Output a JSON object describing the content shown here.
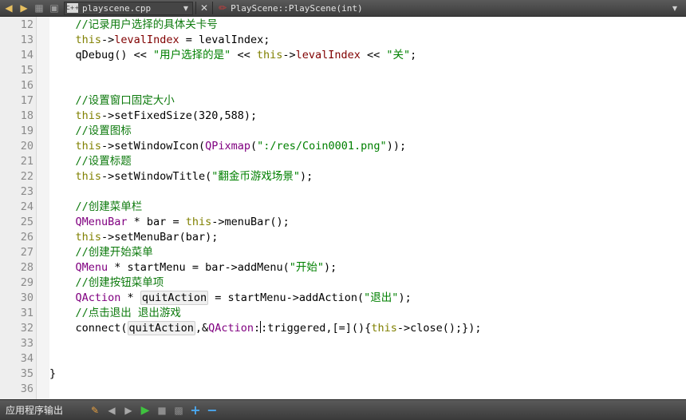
{
  "toolbar": {
    "file_name": "playscene.cpp",
    "file_badge": "C++",
    "symbol": "PlayScene::PlayScene(int)"
  },
  "editor": {
    "lines": [
      {
        "n": "12",
        "tokens": [
          {
            "t": "    //记录用户选择的具体关卡号",
            "c": "com"
          }
        ]
      },
      {
        "n": "13",
        "tokens": [
          {
            "t": "    ",
            "c": "def"
          },
          {
            "t": "this",
            "c": "kw"
          },
          {
            "t": "->",
            "c": "def"
          },
          {
            "t": "levalIndex",
            "c": "mem"
          },
          {
            "t": " = levalIndex;",
            "c": "def"
          }
        ]
      },
      {
        "n": "14",
        "tokens": [
          {
            "t": "    qDebug() << ",
            "c": "def"
          },
          {
            "t": "\"用户选择的是\"",
            "c": "str"
          },
          {
            "t": " << ",
            "c": "def"
          },
          {
            "t": "this",
            "c": "kw"
          },
          {
            "t": "->",
            "c": "def"
          },
          {
            "t": "levalIndex",
            "c": "mem"
          },
          {
            "t": " << ",
            "c": "def"
          },
          {
            "t": "\"关\"",
            "c": "str"
          },
          {
            "t": ";",
            "c": "def"
          }
        ]
      },
      {
        "n": "15",
        "tokens": []
      },
      {
        "n": "16",
        "tokens": []
      },
      {
        "n": "17",
        "tokens": [
          {
            "t": "    //设置窗口固定大小",
            "c": "com"
          }
        ]
      },
      {
        "n": "18",
        "tokens": [
          {
            "t": "    ",
            "c": "def"
          },
          {
            "t": "this",
            "c": "kw"
          },
          {
            "t": "->setFixedSize(320,588);",
            "c": "def"
          }
        ]
      },
      {
        "n": "19",
        "tokens": [
          {
            "t": "    //设置图标",
            "c": "com"
          }
        ]
      },
      {
        "n": "20",
        "tokens": [
          {
            "t": "    ",
            "c": "def"
          },
          {
            "t": "this",
            "c": "kw"
          },
          {
            "t": "->setWindowIcon(",
            "c": "def"
          },
          {
            "t": "QPixmap",
            "c": "type"
          },
          {
            "t": "(",
            "c": "def"
          },
          {
            "t": "\":/res/Coin0001.png\"",
            "c": "str"
          },
          {
            "t": "));",
            "c": "def"
          }
        ]
      },
      {
        "n": "21",
        "tokens": [
          {
            "t": "    //设置标题",
            "c": "com"
          }
        ]
      },
      {
        "n": "22",
        "tokens": [
          {
            "t": "    ",
            "c": "def"
          },
          {
            "t": "this",
            "c": "kw"
          },
          {
            "t": "->setWindowTitle(",
            "c": "def"
          },
          {
            "t": "\"翻金币游戏场景\"",
            "c": "str"
          },
          {
            "t": ");",
            "c": "def"
          }
        ]
      },
      {
        "n": "23",
        "tokens": []
      },
      {
        "n": "24",
        "tokens": [
          {
            "t": "    //创建菜单栏",
            "c": "com"
          }
        ]
      },
      {
        "n": "25",
        "tokens": [
          {
            "t": "    ",
            "c": "def"
          },
          {
            "t": "QMenuBar",
            "c": "type"
          },
          {
            "t": " * bar = ",
            "c": "def"
          },
          {
            "t": "this",
            "c": "kw"
          },
          {
            "t": "->menuBar();",
            "c": "def"
          }
        ]
      },
      {
        "n": "26",
        "tokens": [
          {
            "t": "    ",
            "c": "def"
          },
          {
            "t": "this",
            "c": "kw"
          },
          {
            "t": "->setMenuBar(bar);",
            "c": "def"
          }
        ]
      },
      {
        "n": "27",
        "tokens": [
          {
            "t": "    //创建开始菜单",
            "c": "com"
          }
        ]
      },
      {
        "n": "28",
        "tokens": [
          {
            "t": "    ",
            "c": "def"
          },
          {
            "t": "QMenu",
            "c": "type"
          },
          {
            "t": " * startMenu = bar->addMenu(",
            "c": "def"
          },
          {
            "t": "\"开始\"",
            "c": "str"
          },
          {
            "t": ");",
            "c": "def"
          }
        ]
      },
      {
        "n": "29",
        "tokens": [
          {
            "t": "    //创建按钮菜单项",
            "c": "com"
          }
        ]
      },
      {
        "n": "30",
        "tokens": [
          {
            "t": "    ",
            "c": "def"
          },
          {
            "t": "QAction",
            "c": "type"
          },
          {
            "t": " * ",
            "c": "def"
          },
          {
            "t": "quitAction",
            "c": "hl"
          },
          {
            "t": " = startMenu->addAction(",
            "c": "def"
          },
          {
            "t": "\"退出\"",
            "c": "str"
          },
          {
            "t": ");",
            "c": "def"
          }
        ]
      },
      {
        "n": "31",
        "tokens": [
          {
            "t": "    //点击退出 退出游戏",
            "c": "com"
          }
        ]
      },
      {
        "n": "32",
        "tokens": [
          {
            "t": "    connect(",
            "c": "def"
          },
          {
            "t": "quitAction",
            "c": "hl"
          },
          {
            "t": ",&",
            "c": "def"
          },
          {
            "t": "QAction",
            "c": "type"
          },
          {
            "t": ":",
            "c": "def"
          },
          {
            "t": "",
            "c": "cursor"
          },
          {
            "t": ":triggered,[=](){",
            "c": "def"
          },
          {
            "t": "this",
            "c": "kw"
          },
          {
            "t": "->close();});",
            "c": "def"
          }
        ]
      },
      {
        "n": "33",
        "tokens": []
      },
      {
        "n": "34",
        "tokens": []
      },
      {
        "n": "35",
        "tokens": [
          {
            "t": "}",
            "c": "def"
          }
        ]
      },
      {
        "n": "36",
        "tokens": []
      }
    ]
  },
  "output": {
    "label": "应用程序输出"
  },
  "colors": {
    "comment": "#0d7a0d",
    "keyword": "#808000",
    "member": "#800000",
    "type": "#800080",
    "string": "#008000"
  }
}
